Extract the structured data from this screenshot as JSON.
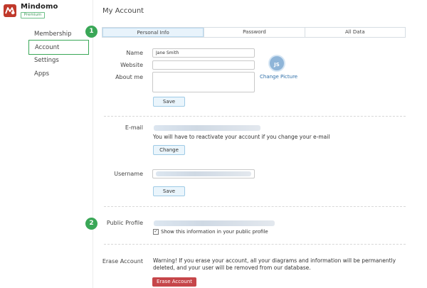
{
  "app": {
    "name": "Mindomo",
    "badge": "Premium",
    "logo_text": "M"
  },
  "sidebar": {
    "items": [
      {
        "label": "Membership"
      },
      {
        "label": "Account",
        "active": true
      },
      {
        "label": "Settings"
      },
      {
        "label": "Apps"
      }
    ]
  },
  "page": {
    "title": "My Account"
  },
  "steps": [
    "1",
    "2"
  ],
  "tabs": [
    {
      "label": "Personal Info",
      "active": true
    },
    {
      "label": "Password"
    },
    {
      "label": "All Data"
    }
  ],
  "personal": {
    "name_label": "Name",
    "name_value": "Jane Smith",
    "website_label": "Website",
    "website_value": "",
    "about_label": "About me",
    "about_value": "",
    "save_label": "Save",
    "avatar_initials": "JS",
    "change_picture_label": "Change Picture"
  },
  "email": {
    "label": "E-mail",
    "note": "You will have to reactivate your account if you change your e-mail",
    "change_label": "Change"
  },
  "username": {
    "label": "Username",
    "save_label": "Save"
  },
  "public_profile": {
    "label": "Public Profile",
    "checkbox_label": "Show this information in your public profile",
    "checked": true,
    "check_mark": "✓"
  },
  "erase": {
    "label": "Erase Account",
    "warning": "Warning! If you erase your account, all your diagrams and information will be permanently deleted, and your user will be removed from our database.",
    "button_label": "Erase Account"
  },
  "colors": {
    "accent_green": "#3aa757",
    "danger_red": "#c6464a",
    "link_blue": "#2f6fa8",
    "brand_red": "#c0392b"
  }
}
